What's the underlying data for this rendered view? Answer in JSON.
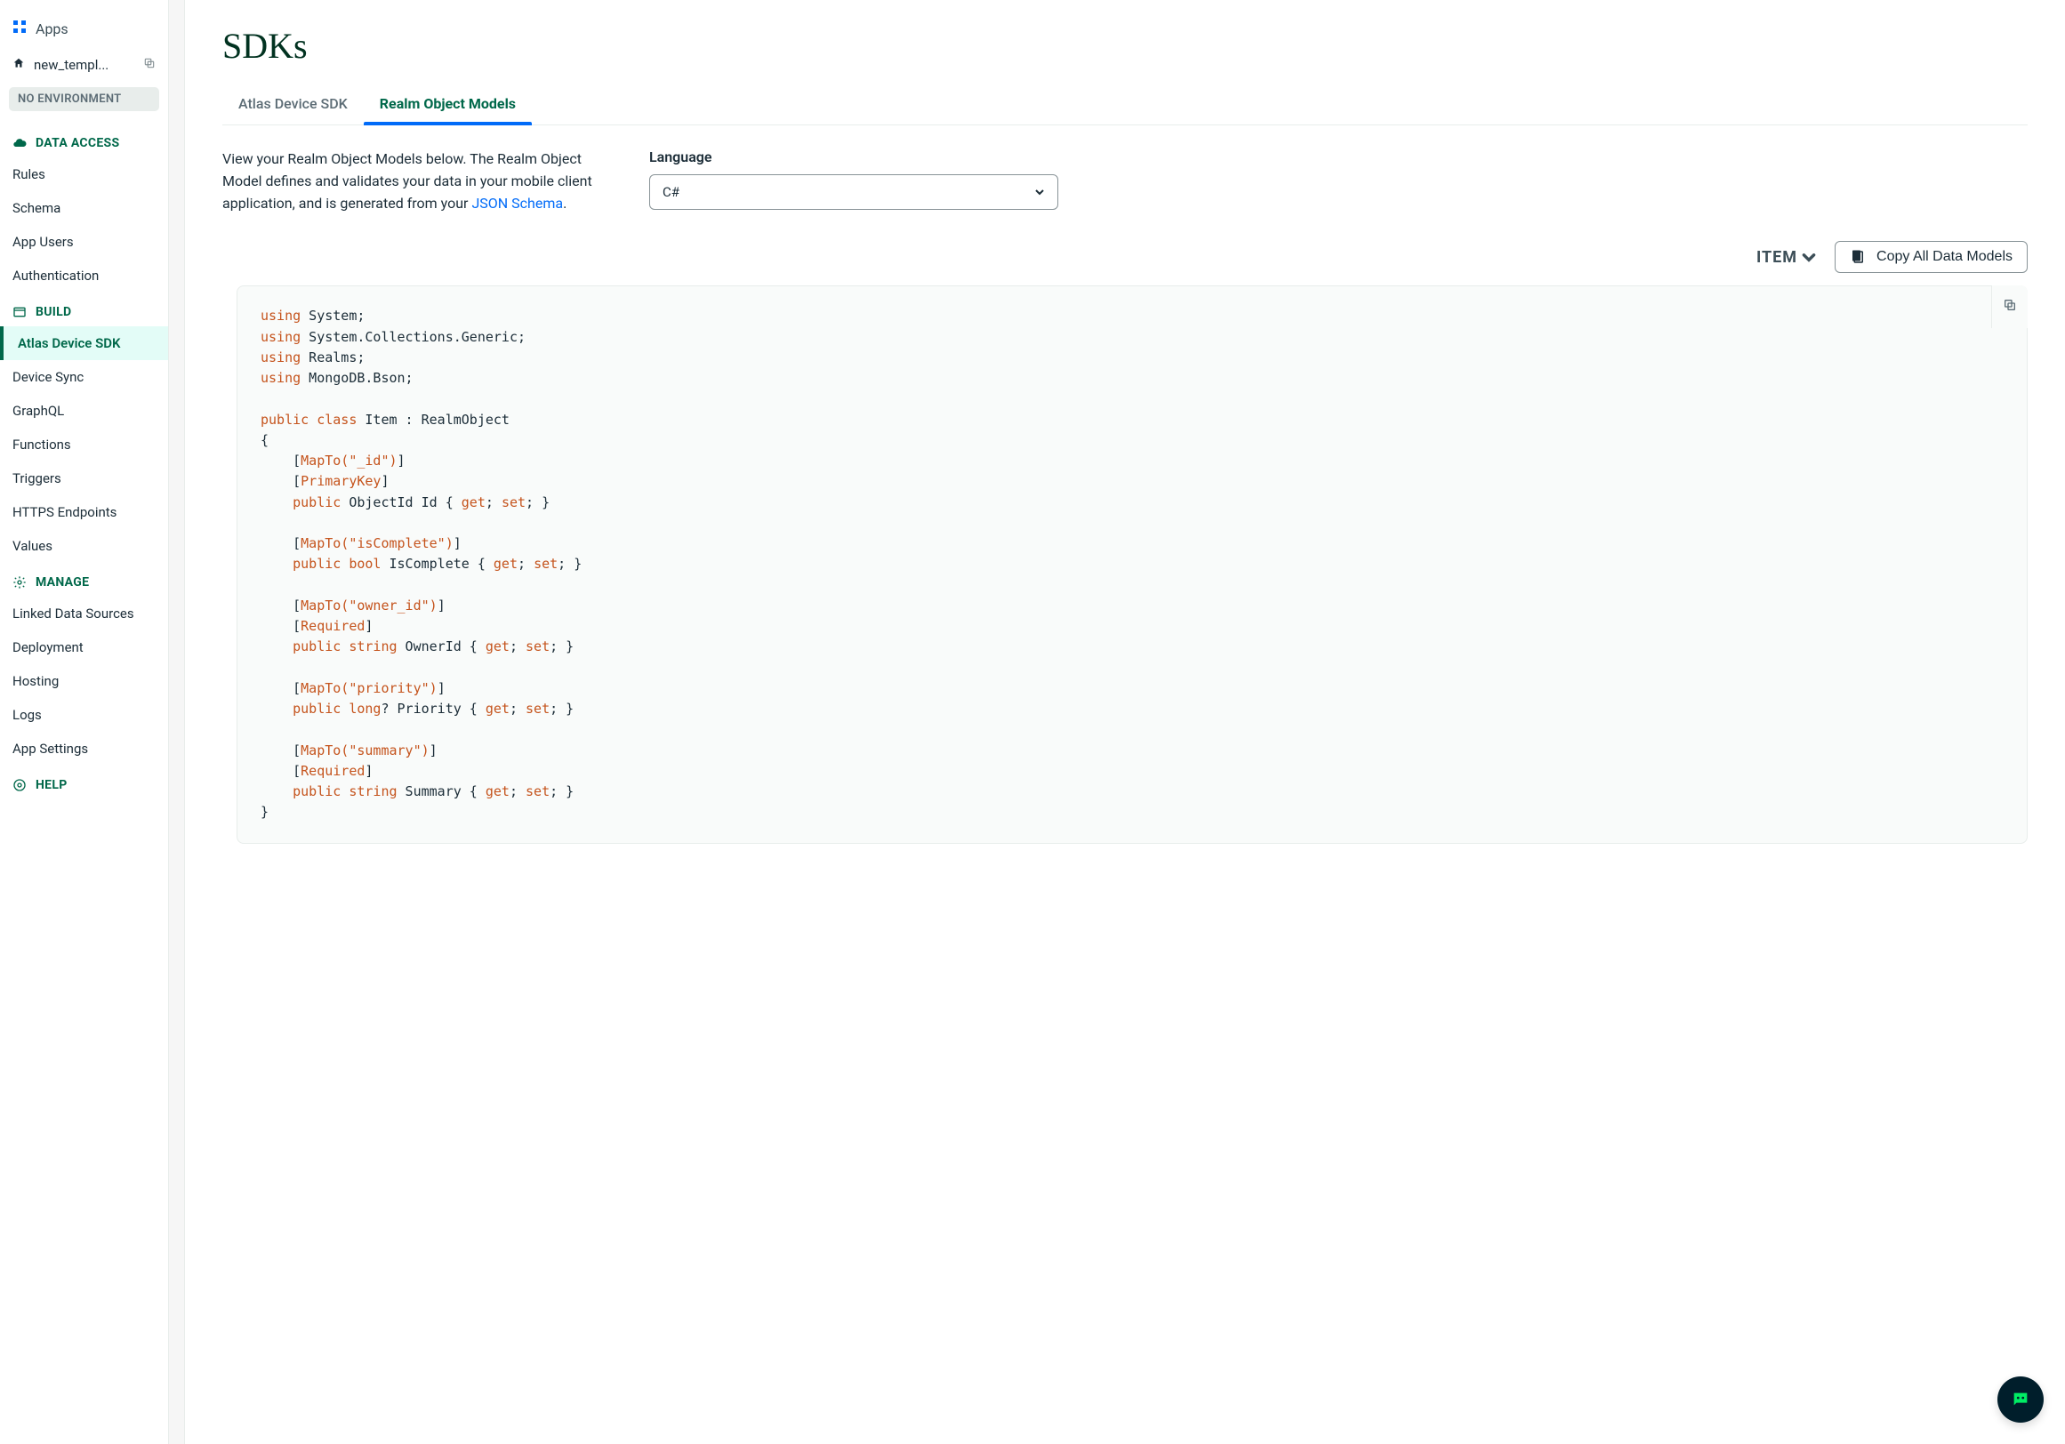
{
  "sidebar": {
    "apps_label": "Apps",
    "project_name": "new_templ...",
    "env_pill": "NO ENVIRONMENT",
    "sections": {
      "data_access": {
        "label": "DATA ACCESS",
        "items": [
          "Rules",
          "Schema",
          "App Users",
          "Authentication"
        ]
      },
      "build": {
        "label": "BUILD",
        "items": [
          "Atlas Device SDK",
          "Device Sync",
          "GraphQL",
          "Functions",
          "Triggers",
          "HTTPS Endpoints",
          "Values"
        ],
        "active_index": 0
      },
      "manage": {
        "label": "MANAGE",
        "items": [
          "Linked Data Sources",
          "Deployment",
          "Hosting",
          "Logs",
          "App Settings"
        ]
      },
      "help": {
        "label": "HELP"
      }
    }
  },
  "main": {
    "title": "SDKs",
    "tabs": [
      "Atlas Device SDK",
      "Realm Object Models"
    ],
    "active_tab": 1,
    "description_text": "View your Realm Object Models below. The Realm Object Model defines and validates your data in your mobile client application, and is generated from your ",
    "description_link": "JSON Schema",
    "description_suffix": ".",
    "language_label": "Language",
    "language_value": "C#",
    "item_toggle": "ITEM",
    "copy_all_btn": "Copy All Data Models",
    "code_lines": [
      {
        "t": "using",
        "s": " System;"
      },
      {
        "t": "using",
        "s": " System.Collections.Generic;"
      },
      {
        "t": "using",
        "s": " Realms;"
      },
      {
        "t": "using",
        "s": " MongoDB.Bson;"
      },
      {
        "blank": true
      },
      {
        "parts": [
          {
            "k": "public"
          },
          {
            "p": " "
          },
          {
            "k": "class"
          },
          {
            "p": " Item : RealmObject"
          }
        ]
      },
      {
        "p": "{"
      },
      {
        "parts": [
          {
            "p": "    ["
          },
          {
            "a": "MapTo("
          },
          {
            "str": "\"_id\""
          },
          {
            "a": ")"
          },
          {
            "p": "]"
          }
        ]
      },
      {
        "parts": [
          {
            "p": "    ["
          },
          {
            "a": "PrimaryKey"
          },
          {
            "p": "]"
          }
        ]
      },
      {
        "parts": [
          {
            "p": "    "
          },
          {
            "k": "public"
          },
          {
            "p": " ObjectId Id { "
          },
          {
            "k": "get"
          },
          {
            "p": "; "
          },
          {
            "k": "set"
          },
          {
            "p": "; }"
          }
        ]
      },
      {
        "blank": true
      },
      {
        "parts": [
          {
            "p": "    ["
          },
          {
            "a": "MapTo("
          },
          {
            "str": "\"isComplete\""
          },
          {
            "a": ")"
          },
          {
            "p": "]"
          }
        ]
      },
      {
        "parts": [
          {
            "p": "    "
          },
          {
            "k": "public"
          },
          {
            "p": " "
          },
          {
            "k": "bool"
          },
          {
            "p": " IsComplete { "
          },
          {
            "k": "get"
          },
          {
            "p": "; "
          },
          {
            "k": "set"
          },
          {
            "p": "; }"
          }
        ]
      },
      {
        "blank": true
      },
      {
        "parts": [
          {
            "p": "    ["
          },
          {
            "a": "MapTo("
          },
          {
            "str": "\"owner_id\""
          },
          {
            "a": ")"
          },
          {
            "p": "]"
          }
        ]
      },
      {
        "parts": [
          {
            "p": "    ["
          },
          {
            "a": "Required"
          },
          {
            "p": "]"
          }
        ]
      },
      {
        "parts": [
          {
            "p": "    "
          },
          {
            "k": "public"
          },
          {
            "p": " "
          },
          {
            "k": "string"
          },
          {
            "p": " OwnerId { "
          },
          {
            "k": "get"
          },
          {
            "p": "; "
          },
          {
            "k": "set"
          },
          {
            "p": "; }"
          }
        ]
      },
      {
        "blank": true
      },
      {
        "parts": [
          {
            "p": "    ["
          },
          {
            "a": "MapTo("
          },
          {
            "str": "\"priority\""
          },
          {
            "a": ")"
          },
          {
            "p": "]"
          }
        ]
      },
      {
        "parts": [
          {
            "p": "    "
          },
          {
            "k": "public"
          },
          {
            "p": " "
          },
          {
            "k": "long"
          },
          {
            "p": "? Priority { "
          },
          {
            "k": "get"
          },
          {
            "p": "; "
          },
          {
            "k": "set"
          },
          {
            "p": "; }"
          }
        ]
      },
      {
        "blank": true
      },
      {
        "parts": [
          {
            "p": "    ["
          },
          {
            "a": "MapTo("
          },
          {
            "str": "\"summary\""
          },
          {
            "a": ")"
          },
          {
            "p": "]"
          }
        ]
      },
      {
        "parts": [
          {
            "p": "    ["
          },
          {
            "a": "Required"
          },
          {
            "p": "]"
          }
        ]
      },
      {
        "parts": [
          {
            "p": "    "
          },
          {
            "k": "public"
          },
          {
            "p": " "
          },
          {
            "k": "string"
          },
          {
            "p": " Summary { "
          },
          {
            "k": "get"
          },
          {
            "p": "; "
          },
          {
            "k": "set"
          },
          {
            "p": "; }"
          }
        ]
      },
      {
        "p": "}"
      }
    ]
  }
}
